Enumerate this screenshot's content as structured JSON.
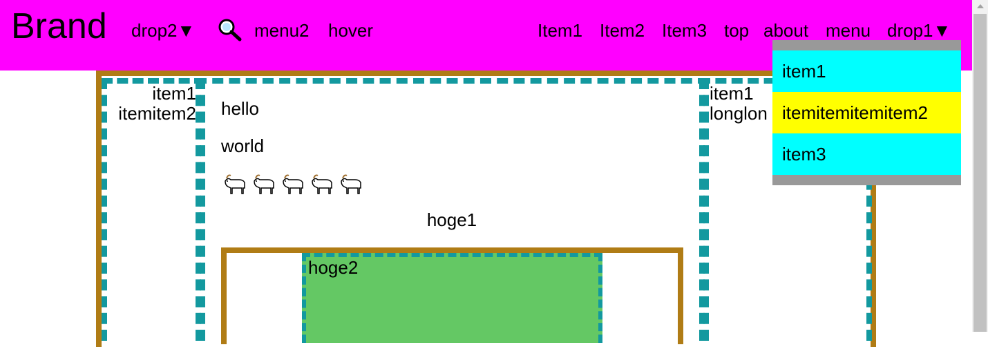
{
  "navbar": {
    "brand": "Brand",
    "left_links": [
      "drop2▼",
      "menu2",
      "hover"
    ],
    "search_icon": "magnifier-icon",
    "right_links": [
      "Item1",
      "Item2",
      "Item3",
      "top",
      "about",
      "menu",
      "drop1▼"
    ],
    "background": "#ff00ff"
  },
  "dropdown": {
    "items": [
      {
        "label": "item1",
        "color": "#00ffff"
      },
      {
        "label": "itemitemitemitem2",
        "color": "#ffff00"
      },
      {
        "label": "item3",
        "color": "#00ffff"
      }
    ]
  },
  "sidebar_left": {
    "lines": [
      "item1",
      "itemitem2"
    ]
  },
  "sidebar_right": {
    "lines": [
      "item1",
      "longlon"
    ]
  },
  "main": {
    "hello": "hello",
    "world": "world",
    "goats": [
      "goat-icon",
      "goat-icon",
      "goat-icon",
      "goat-icon",
      "goat-icon"
    ],
    "hoge1": "hoge1",
    "hoge2": "hoge2"
  },
  "colors": {
    "frame_border": "#b07c15",
    "column_border": "#13999f",
    "green_box": "#64c864"
  }
}
